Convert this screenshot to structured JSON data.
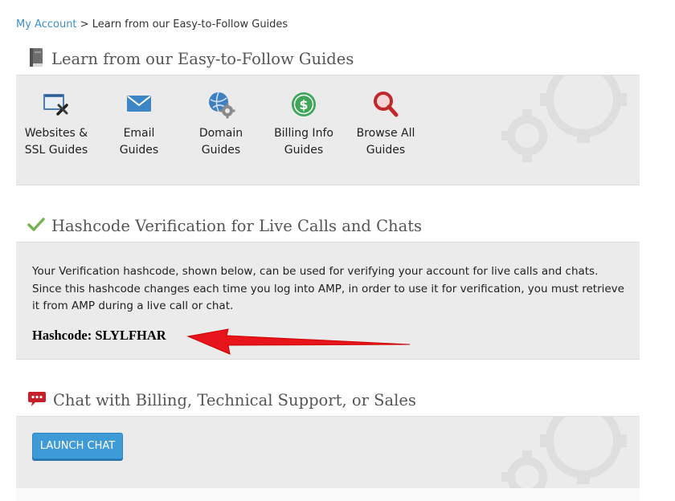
{
  "breadcrumb": {
    "link": "My Account",
    "separator": ">",
    "current": "Learn from our Easy-to-Follow Guides"
  },
  "guides_panel": {
    "title": "Learn from our Easy-to-Follow Guides",
    "icon": "book-icon",
    "items": [
      {
        "label": "Websites &\nSSL Guides",
        "icon": "website-tools-icon"
      },
      {
        "label": "Email\nGuides",
        "icon": "envelope-icon"
      },
      {
        "label": "Domain\nGuides",
        "icon": "globe-gear-icon"
      },
      {
        "label": "Billing Info\nGuides",
        "icon": "dollar-circle-icon"
      },
      {
        "label": "Browse All\nGuides",
        "icon": "magnifier-icon"
      }
    ]
  },
  "hashcode_panel": {
    "title": "Hashcode Verification for Live Calls and Chats",
    "icon": "checkmark-icon",
    "description": "Your Verification hashcode, shown below, can be used for verifying your account for live calls and chats. Since this hashcode changes each time you log into AMP, in order to use it for verification, you must retrieve it from AMP during a live call or chat.",
    "hashcode_label": "Hashcode:",
    "hashcode_value": "SLYLFHAR",
    "annotation_color": "#e8141c"
  },
  "chat_panel": {
    "title": "Chat with Billing, Technical Support, or Sales",
    "icon": "chat-bubble-icon",
    "button_label": "LAUNCH CHAT",
    "button_color": "#3f9ad8"
  }
}
